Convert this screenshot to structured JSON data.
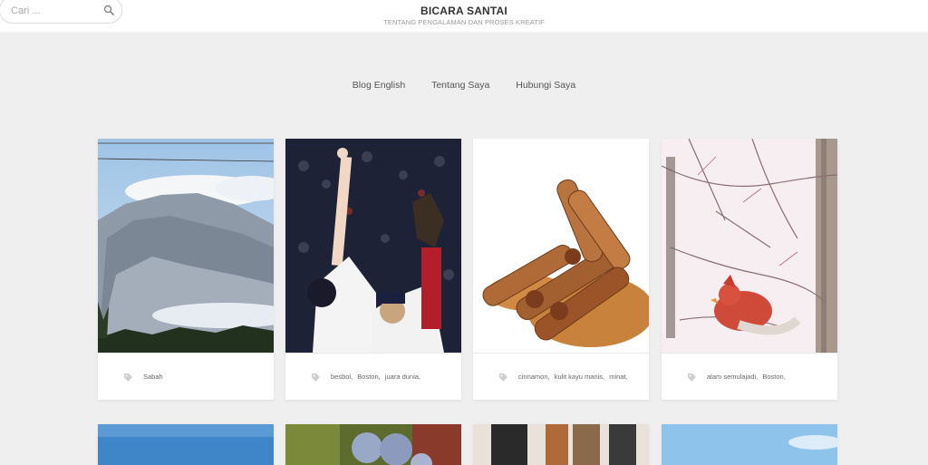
{
  "header": {
    "search_placeholder": "Cari ...",
    "site_title": "BICARA SANTAI",
    "tagline": "TENTANG PENGALAMAN DAN PROSES KREATIF"
  },
  "nav": [
    {
      "label": "Blog English"
    },
    {
      "label": "Tentang Saya"
    },
    {
      "label": "Hubungi Saya"
    }
  ],
  "posts": [
    {
      "image": "mountain",
      "tags": [
        "Sabah"
      ]
    },
    {
      "image": "baseball",
      "tags": [
        "besbol,",
        "Boston,",
        "juara dunia,"
      ]
    },
    {
      "image": "cinnamon",
      "tags": [
        "cinnamon,",
        "kulit kayu manis,",
        "minat,"
      ]
    },
    {
      "image": "cardinal-bird",
      "tags": [
        "alam semulajadi,",
        "Boston,"
      ]
    }
  ],
  "colors": {
    "background": "#efefef",
    "header_bg": "#ffffff",
    "title": "#333333",
    "nav_text": "#555555"
  }
}
